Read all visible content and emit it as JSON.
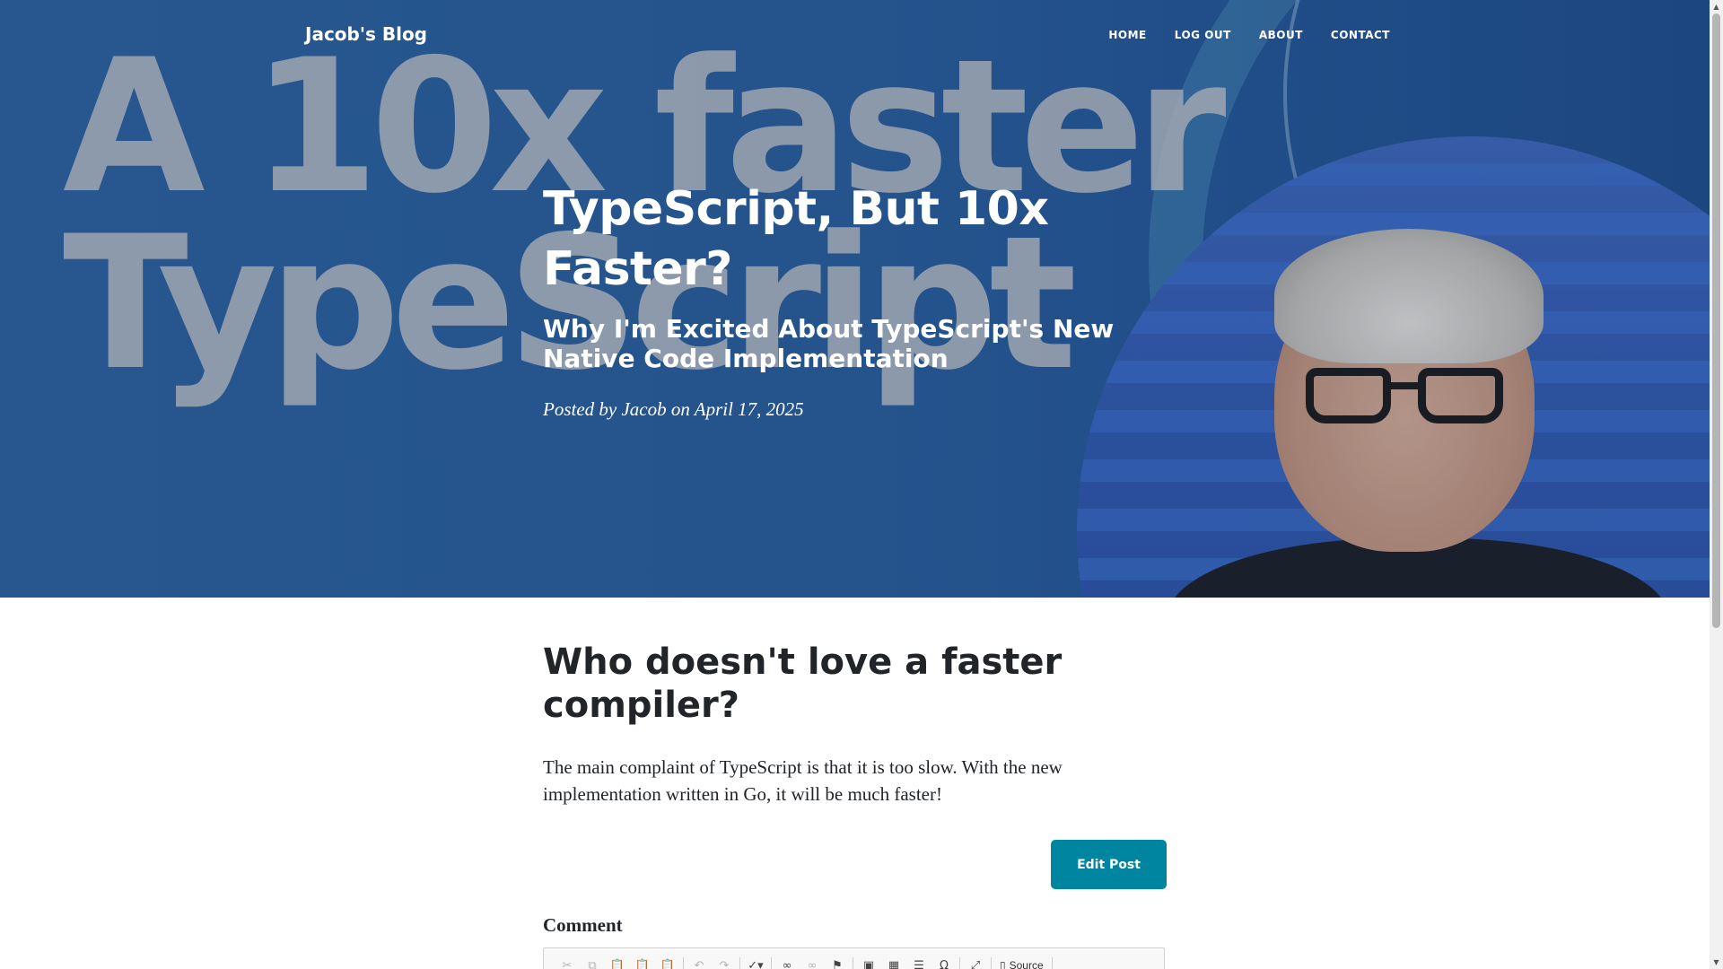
{
  "hero": {
    "background_text_line1": "A 10x faster",
    "background_text_line2": "TypeScript"
  },
  "nav": {
    "brand": "Jacob's Blog",
    "links": [
      "HOME",
      "LOG OUT",
      "ABOUT",
      "CONTACT"
    ]
  },
  "post": {
    "title": "TypeScript, But 10x Faster?",
    "subtitle": "Why I'm Excited About TypeScript's New Native Code Implementation",
    "meta": "Posted by Jacob on April 17, 2025",
    "section_heading": "Who doesn't love a faster compiler?",
    "body": "The main complaint of TypeScript is that it is too slow. With the new implementation written in Go, it will be much faster!",
    "edit_button": "Edit Post"
  },
  "comment": {
    "label": "Comment",
    "toolbar": {
      "source_label": "Source",
      "icons": [
        "cut-icon",
        "copy-icon",
        "paste-icon",
        "paste-text-icon",
        "paste-word-icon",
        "undo-icon",
        "redo-icon",
        "spellcheck-icon",
        "link-icon",
        "unlink-icon",
        "anchor-icon",
        "image-icon",
        "table-icon",
        "horizontal-rule-icon",
        "special-char-icon",
        "maximize-icon",
        "source-icon"
      ]
    }
  },
  "colors": {
    "hero_blue": "#2a5c95",
    "button": "#0085a1",
    "text": "#212529"
  }
}
